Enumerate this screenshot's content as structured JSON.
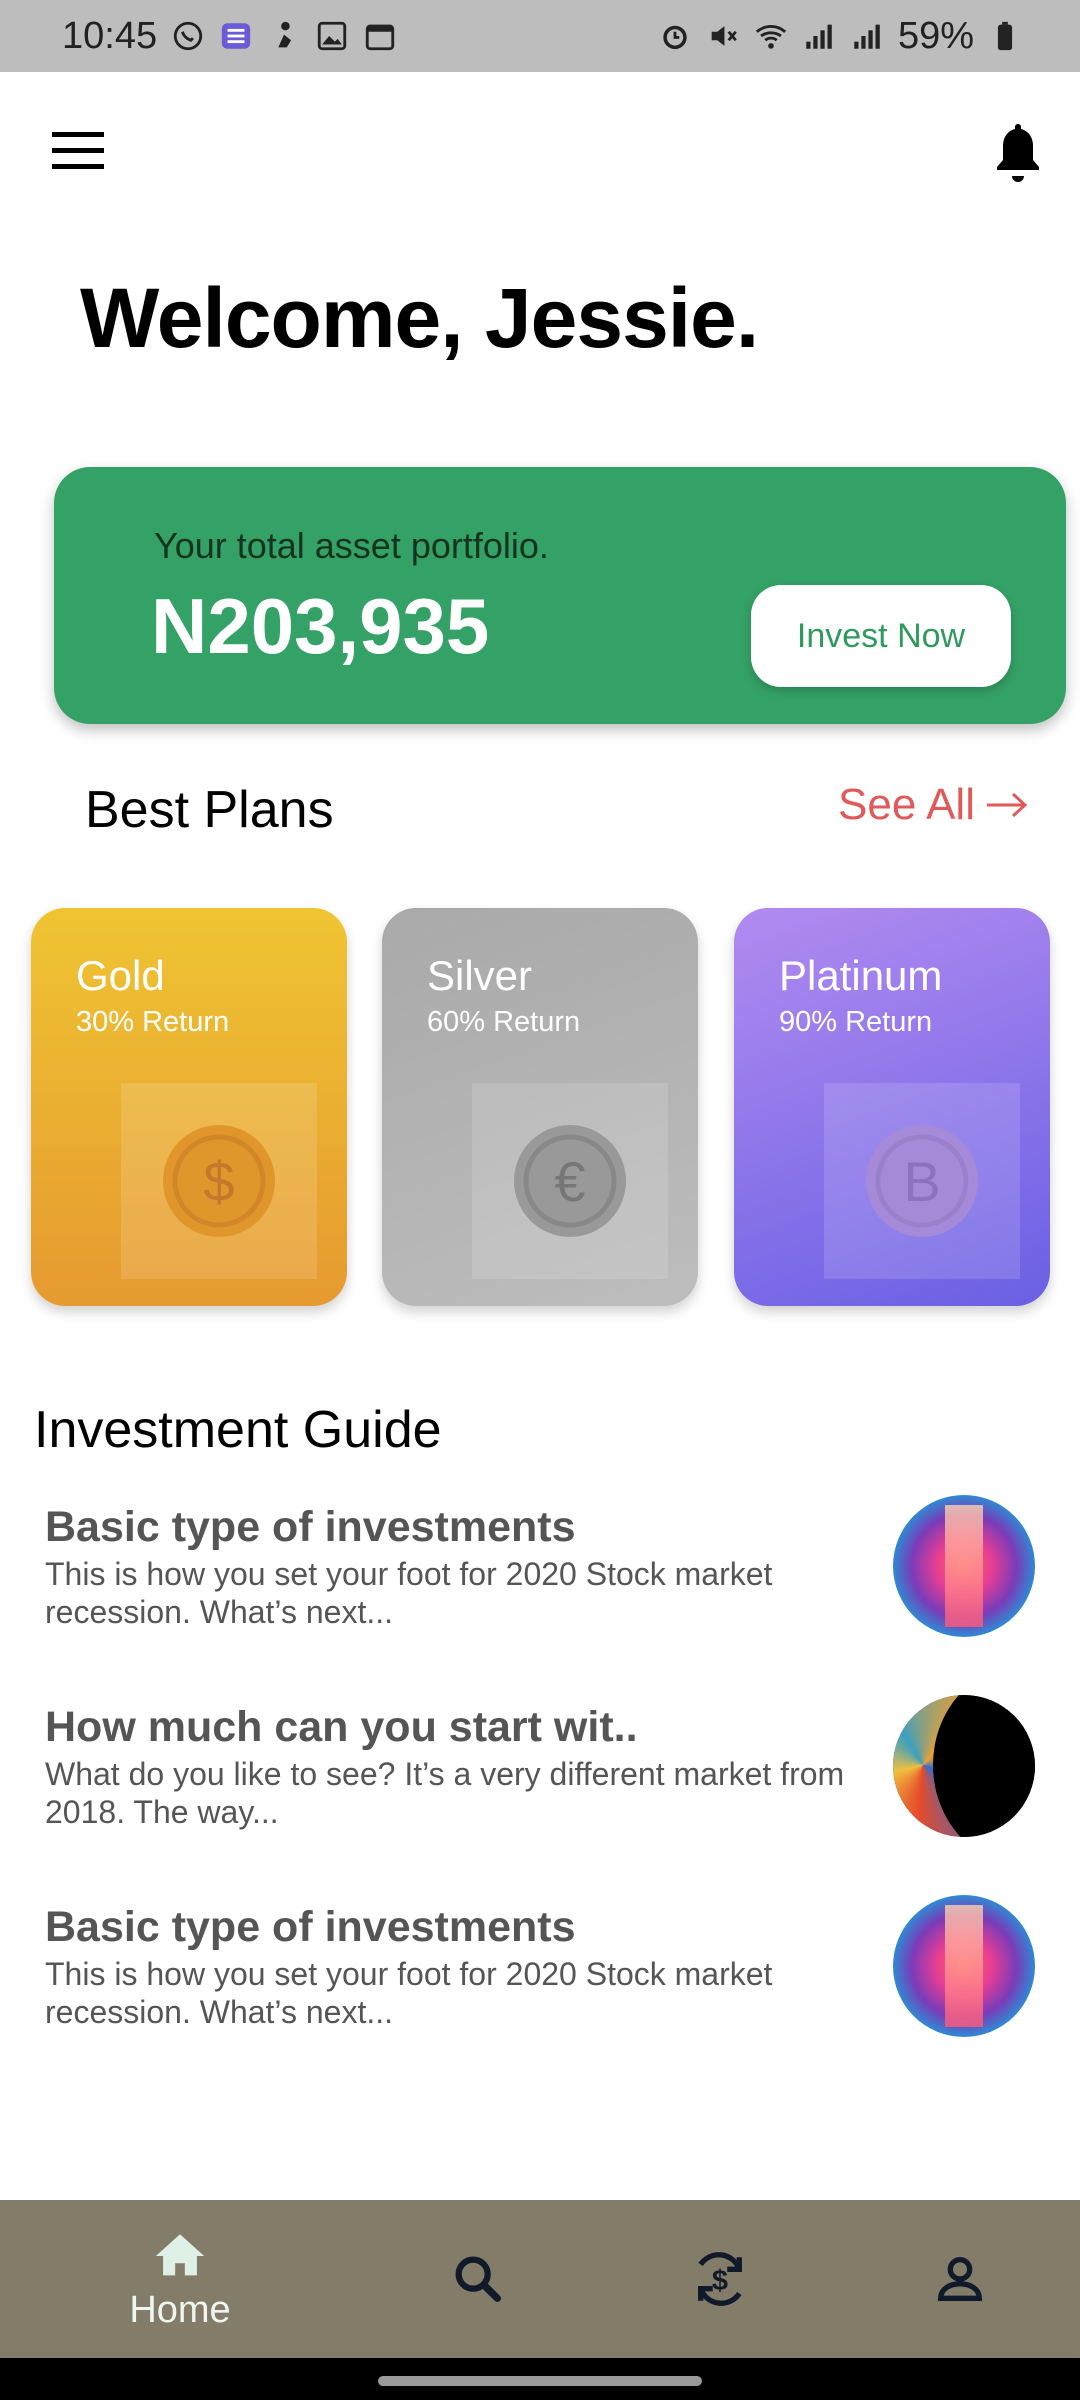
{
  "status_bar": {
    "time": "10:45",
    "battery": "59%",
    "icons_left": [
      "whatsapp-icon",
      "list-app-icon",
      "skater-app-icon",
      "gallery-icon",
      "calendar-icon"
    ],
    "icons_right": [
      "alarm-icon",
      "mute-icon",
      "wifi-icon",
      "signal-icon",
      "signal-icon",
      "battery-icon"
    ]
  },
  "header": {
    "menu_icon": "hamburger-menu-icon",
    "notification_icon": "bell-icon"
  },
  "welcome": "Welcome, Jessie.",
  "portfolio": {
    "label": "Your total asset portfolio.",
    "amount": "N203,935",
    "button_label": "Invest Now",
    "color": "#34a266"
  },
  "best_plans": {
    "title": "Best Plans",
    "see_all": "See All",
    "plans": [
      {
        "name": "Gold",
        "return": "30% Return",
        "icon": "dollar-coin-icon"
      },
      {
        "name": "Silver",
        "return": "60% Return",
        "icon": "euro-coin-icon"
      },
      {
        "name": "Platinum",
        "return": "90% Return",
        "icon": "bitcoin-coin-icon"
      }
    ]
  },
  "guide": {
    "title": "Investment Guide",
    "items": [
      {
        "heading": "Basic type of investments",
        "description": "This is how you set your foot for 2020 Stock market recession. What’s next..."
      },
      {
        "heading": "How much can you start wit..",
        "description": "What do you like to see? It’s a very different market from 2018. The way..."
      },
      {
        "heading": "Basic type of investments",
        "description": "This is how you set your foot for 2020 Stock market recession. What’s next..."
      }
    ]
  },
  "bottom_nav": {
    "home_label": "Home",
    "items": [
      "home-icon",
      "search-icon",
      "currency-exchange-icon",
      "profile-icon"
    ],
    "background": "#837c68"
  }
}
